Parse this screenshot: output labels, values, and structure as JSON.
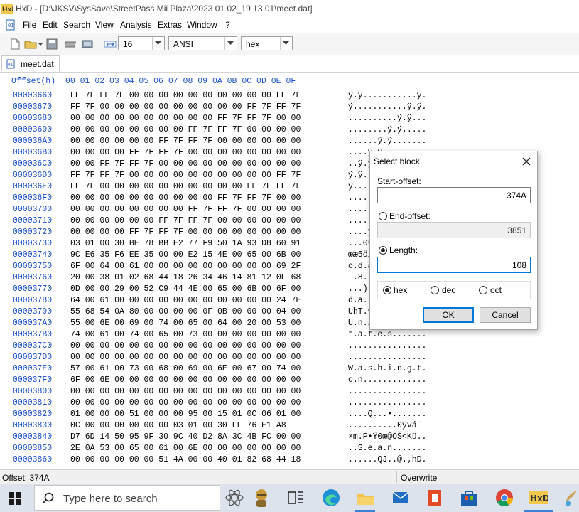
{
  "window": {
    "title": "HxD - [D:\\JKSV\\SysSave\\StreetPass Mii Plaza\\2023 01 02_19 13 01\\meet.dat]"
  },
  "menu": {
    "items": [
      "File",
      "Edit",
      "Search",
      "View",
      "Analysis",
      "Extras",
      "Window",
      "?"
    ]
  },
  "toolbar": {
    "bytes_per_row": "16",
    "charset": "ANSI",
    "offset_base": "hex"
  },
  "tab": {
    "label": "meet.dat"
  },
  "hex_header": "Offset(h)  00 01 02 03 04 05 06 07 08 09 0A 0B 0C 0D 0E 0F",
  "rows": [
    {
      "offset": "00003660",
      "bytes": "FF 7F FF 7F 00 00 00 00 00 00 00 00 00 00 FF 7F",
      "ascii": "ÿ.ÿ...........ÿ."
    },
    {
      "offset": "00003670",
      "bytes": "FF 7F 00 00 00 00 00 00 00 00 00 00 FF 7F FF 7F",
      "ascii": "ÿ...........ÿ.ÿ."
    },
    {
      "offset": "00003680",
      "bytes": "00 00 00 00 00 00 00 00 00 00 FF 7F FF 7F 00 00",
      "ascii": "..........ÿ.ÿ..."
    },
    {
      "offset": "00003690",
      "bytes": "00 00 00 00 00 00 00 00 FF 7F FF 7F 00 00 00 00",
      "ascii": "........ÿ.ÿ....."
    },
    {
      "offset": "000036A0",
      "bytes": "00 00 00 00 00 00 FF 7F FF 7F 00 00 00 00 00 00",
      "ascii": "......ÿ.ÿ......."
    },
    {
      "offset": "000036B0",
      "bytes": "00 00 00 00 FF 7F FF 7F 00 00 00 00 00 00 00 00",
      "ascii": "....ÿ.ÿ........."
    },
    {
      "offset": "000036C0",
      "bytes": "00 00 FF 7F FF 7F 00 00 00 00 00 00 00 00 00 00",
      "ascii": "..ÿ.ÿ..........."
    },
    {
      "offset": "000036D0",
      "bytes": "FF 7F FF 7F 00 00 00 00 00 00 00 00 00 00 FF 7F",
      "ascii": "ÿ.ÿ...........ÿ."
    },
    {
      "offset": "000036E0",
      "bytes": "FF 7F 00 00 00 00 00 00 00 00 00 00 FF 7F FF 7F",
      "ascii": "ÿ...........ÿ.ÿ."
    },
    {
      "offset": "000036F0",
      "bytes": "00 00 00 00 00 00 00 00 00 00 FF 7F FF 7F 00 00",
      "ascii": "..........ÿ.ÿ..."
    },
    {
      "offset": "00003700",
      "bytes": "00 00 00 00 00 00 00 00 FF 7F FF 7F 00 00 00 00",
      "ascii": "........ÿ.ÿ....."
    },
    {
      "offset": "00003710",
      "bytes": "00 00 00 00 00 00 FF 7F FF 7F 00 00 00 00 00 00",
      "ascii": "......ÿ.ÿ......."
    },
    {
      "offset": "00003720",
      "bytes": "00 00 00 00 FF 7F FF 7F 00 00 00 00 00 00 00 00",
      "ascii": "....ÿ.ÿ........."
    },
    {
      "offset": "00003730",
      "bytes": "03 01 00 30 BE 78 BB E2 77 F9 50 1A 93 D8 60 91",
      "ascii": "...0¾x»âwùP.“Ø`‘"
    },
    {
      "offset": "00003740",
      "bytes": "9C E6 35 F6 EE 35 00 00 E2 15 4E 00 65 00 6B 00",
      "ascii": "œæ5öî5..â.N.e.k."
    },
    {
      "offset": "00003750",
      "bytes": "6F 00 64 00 61 00 00 00 00 00 00 00 00 00 69 2F",
      "ascii": "o.d.a.........i/"
    },
    {
      "offset": "00003760",
      "bytes": "20 00 38 01 02 68 44 18 26 34 46 14 81 12 0F 68",
      "ascii": " .8..hD.&4F....h"
    },
    {
      "offset": "00003770",
      "bytes": "0D 00 00 29 00 52 C9 44 4E 00 65 00 6B 00 6F 00",
      "ascii": "...).RÉDN.e.k.o."
    },
    {
      "offset": "00003780",
      "bytes": "64 00 61 00 00 00 00 00 00 00 00 00 00 00 24 7E",
      "ascii": "d.a...........$~"
    },
    {
      "offset": "00003790",
      "bytes": "55 68 54 0A 80 00 00 00 00 0F 0B 00 00 00 04 00",
      "ascii": "UhT.€..........."
    },
    {
      "offset": "000037A0",
      "bytes": "55 00 6E 00 69 00 74 00 65 00 64 00 20 00 53 00",
      "ascii": "U.n.i.t.e.d. .S."
    },
    {
      "offset": "000037B0",
      "bytes": "74 00 61 00 74 00 65 00 73 00 00 00 00 00 00 00",
      "ascii": "t.a.t.e.s......."
    },
    {
      "offset": "000037C0",
      "bytes": "00 00 00 00 00 00 00 00 00 00 00 00 00 00 00 00",
      "ascii": "................"
    },
    {
      "offset": "000037D0",
      "bytes": "00 00 00 00 00 00 00 00 00 00 00 00 00 00 00 00",
      "ascii": "................"
    },
    {
      "offset": "000037E0",
      "bytes": "57 00 61 00 73 00 68 00 69 00 6E 00 67 00 74 00",
      "ascii": "W.a.s.h.i.n.g.t."
    },
    {
      "offset": "000037F0",
      "bytes": "6F 00 6E 00 00 00 00 00 00 00 00 00 00 00 00 00",
      "ascii": "o.n............."
    },
    {
      "offset": "00003800",
      "bytes": "00 00 00 00 00 00 00 00 00 00 00 00 00 00 00 00",
      "ascii": "................"
    },
    {
      "offset": "00003810",
      "bytes": "00 00 00 00 00 00 00 00 00 00 00 00 00 00 00 00",
      "ascii": "................"
    },
    {
      "offset": "00003820",
      "bytes": "01 00 00 00 51 00 00 00 95 00 15 01 0C 06 01 00",
      "ascii": "....Q...•......."
    },
    {
      "offset": "00003830",
      "bytes": "0C 00 00 00 00 00 00 03 01 00 30 FF 76 E1 A8",
      "ascii": "..........0ÿvá¨"
    },
    {
      "offset": "00003840",
      "bytes": "D7 6D 14 50 95 9F 30 9C 40 D2 8A 3C 4B FC 00 00",
      "ascii": "×m.P•Ÿ0œ@ÒŠ<Kü.."
    },
    {
      "offset": "00003850",
      "bytes": "2E 0A 53 00 65 00 61 00 6E 00 00 00 00 00 00 00",
      "ascii": "..S.e.a.n......."
    },
    {
      "offset": "00003860",
      "bytes": "00 00 00 00 00 00 51 4A 00 00 40 01 82 68 44 18",
      "ascii": "......QJ..@.‚hD."
    }
  ],
  "status": {
    "offset": "Offset: 374A",
    "mode": "Overwrite"
  },
  "taskbar": {
    "search_placeholder": "Type here to search"
  },
  "dialog": {
    "title": "Select block",
    "start_label": "Start-offset:",
    "start_value": "374A",
    "end_label": "End-offset:",
    "end_value": "3851",
    "length_label": "Length:",
    "length_value": "108",
    "selected_mode": "Length",
    "radix_options": [
      "hex",
      "dec",
      "oct"
    ],
    "selected_radix": "hex",
    "ok_label": "OK",
    "cancel_label": "Cancel"
  },
  "colors": {
    "offset_blue": "#1b50c8",
    "accent": "#0078d7"
  }
}
